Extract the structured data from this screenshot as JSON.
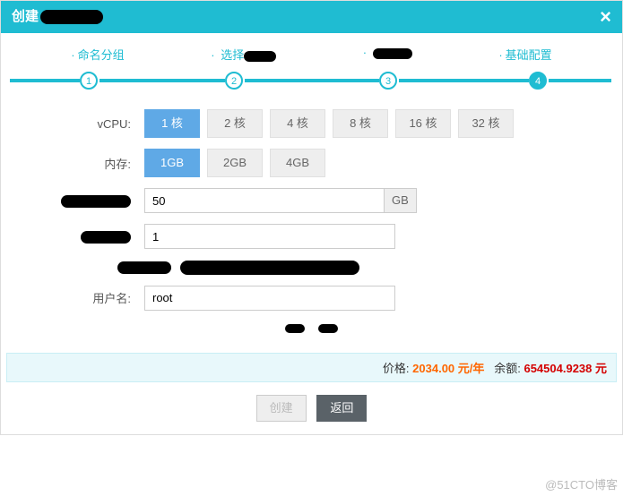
{
  "header": {
    "title_prefix": "创建"
  },
  "steps": {
    "labels": [
      "命名分组",
      "选择",
      "",
      "基础配置"
    ],
    "nums": [
      "1",
      "2",
      "3",
      "4"
    ]
  },
  "form": {
    "vcpu_label": "vCPU:",
    "vcpu_opts": [
      "1 核",
      "2 核",
      "4 核",
      "8 核",
      "16 核",
      "32 核"
    ],
    "mem_label": "内存:",
    "mem_opts": [
      "1GB",
      "2GB",
      "4GB"
    ],
    "disk_value": "50",
    "disk_unit": "GB",
    "count_value": "1",
    "user_label": "用户名:",
    "user_value": "root"
  },
  "footer": {
    "price_label": "价格:",
    "price_value": "2034.00 元/年",
    "balance_label": "余额:",
    "balance_value": "654504.9238 元"
  },
  "buttons": {
    "create": "创建",
    "back": "返回"
  },
  "watermark": "@51CTO博客"
}
